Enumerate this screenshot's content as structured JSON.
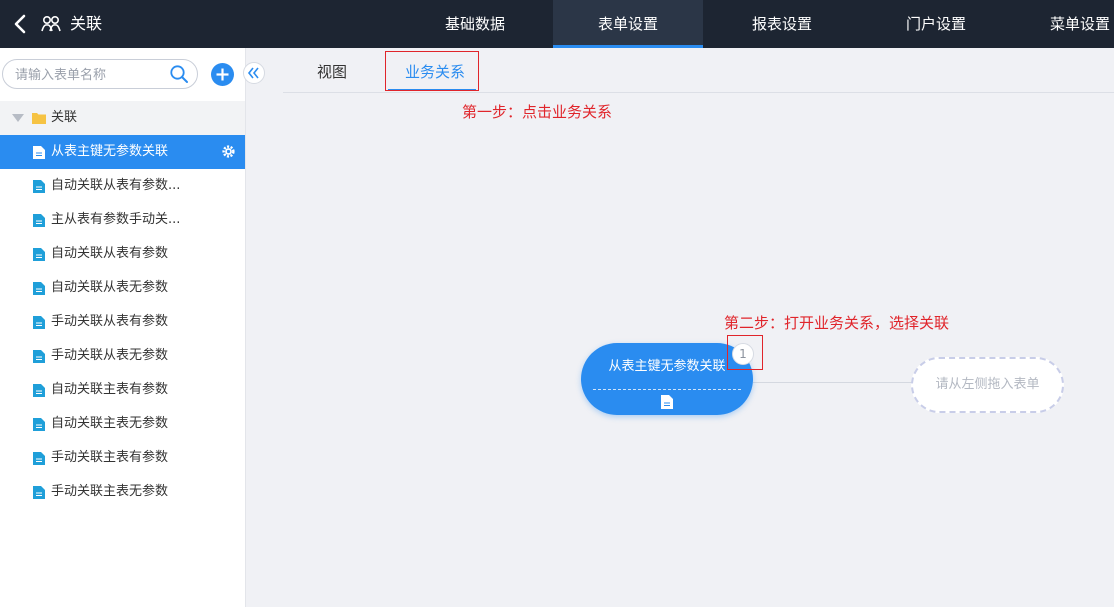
{
  "header": {
    "title": "关联",
    "tabs": [
      {
        "label": "基础数据",
        "active": false
      },
      {
        "label": "表单设置",
        "active": true
      },
      {
        "label": "报表设置",
        "active": false
      },
      {
        "label": "门户设置",
        "active": false
      },
      {
        "label": "菜单设置",
        "active": false
      }
    ]
  },
  "sidebar": {
    "search_placeholder": "请输入表单名称",
    "root_folder": "关联",
    "items": [
      {
        "label": "从表主键无参数关联",
        "selected": true
      },
      {
        "label": "自动关联从表有参数..."
      },
      {
        "label": "主从表有参数手动关..."
      },
      {
        "label": "自动关联从表有参数"
      },
      {
        "label": "自动关联从表无参数"
      },
      {
        "label": "手动关联从表有参数"
      },
      {
        "label": "手动关联从表无参数"
      },
      {
        "label": "自动关联主表有参数"
      },
      {
        "label": "自动关联主表无参数"
      },
      {
        "label": "手动关联主表有参数"
      },
      {
        "label": "手动关联主表无参数"
      }
    ]
  },
  "main": {
    "tabs": [
      {
        "label": "视图",
        "active": false
      },
      {
        "label": "业务关系",
        "active": true
      }
    ],
    "annotations": {
      "step1": "第一步：点击业务关系",
      "step2": "第二步：打开业务关系，选择关联"
    },
    "node": {
      "title": "从表主键无参数关联",
      "badge": "1"
    },
    "drop_target": "请从左侧拖入表单"
  },
  "colors": {
    "accent": "#2a8cf0",
    "topbar": "#1d2532",
    "annotation": "#e0252b"
  }
}
